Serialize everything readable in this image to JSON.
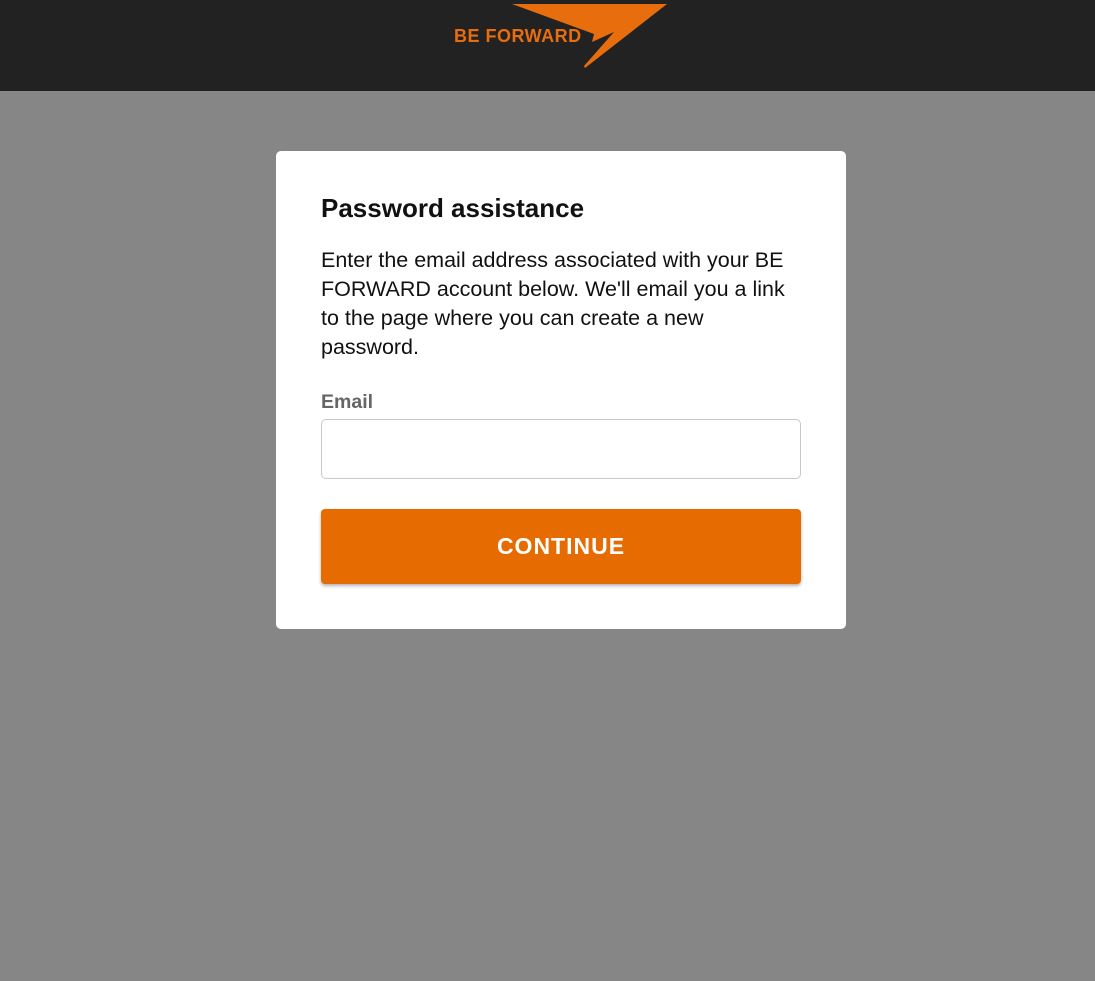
{
  "header": {
    "logo_text": "BE FORWARD",
    "logo_icon": "swoosh-arrow-icon",
    "brand_color": "#E86D0C",
    "background_color": "#222222"
  },
  "card": {
    "title": "Password assistance",
    "description": "Enter the email address associated with your BE FORWARD account below. We'll email you a link to the page where you can create a new password.",
    "email_label": "Email",
    "email_value": "",
    "email_placeholder": "",
    "continue_label": "CONTINUE",
    "button_color": "#E66C02"
  },
  "page": {
    "background_color": "#868686"
  }
}
